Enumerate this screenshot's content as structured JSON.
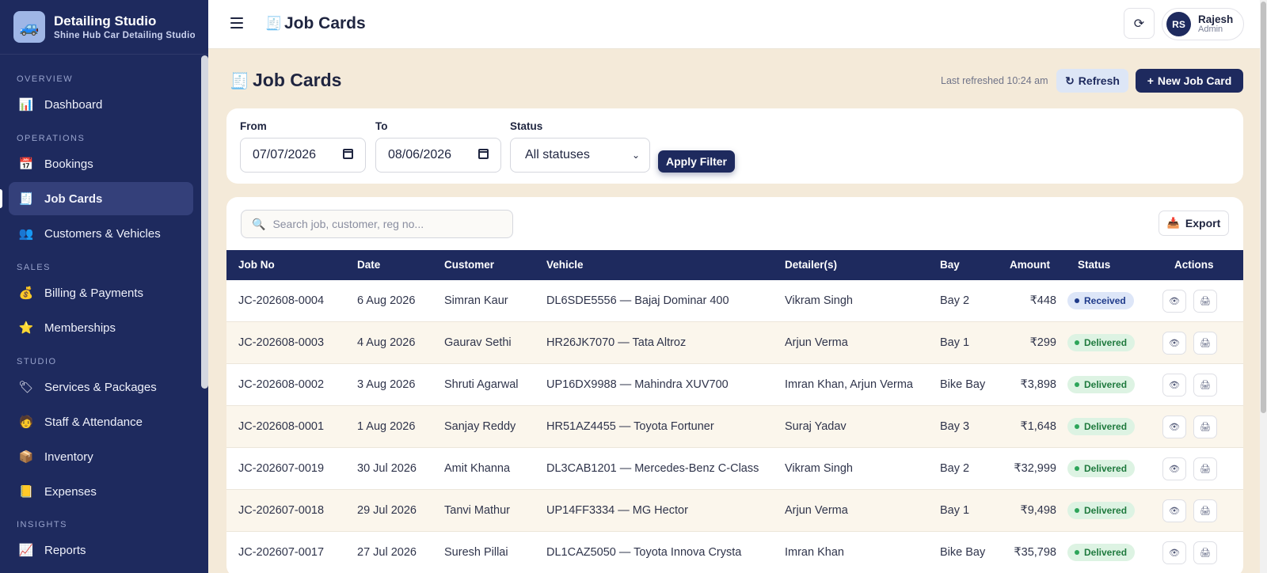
{
  "brand": {
    "logo_icon": "🚙",
    "title": "Detailing Studio",
    "subtitle": "Shine Hub Car Detailing Studio"
  },
  "sidebar": {
    "sections": {
      "overview": "OVERVIEW",
      "operations": "OPERATIONS",
      "sales": "SALES",
      "studio": "STUDIO",
      "insights": "INSIGHTS"
    },
    "items": [
      {
        "label": "Dashboard",
        "icon": "📊",
        "icon_name": "chart-icon"
      },
      {
        "label": "Bookings",
        "icon": "📅",
        "icon_name": "calendar-icon"
      },
      {
        "label": "Job Cards",
        "icon": "🧾",
        "icon_name": "receipt-icon",
        "active": true
      },
      {
        "label": "Customers & Vehicles",
        "icon": "👥",
        "icon_name": "people-icon"
      },
      {
        "label": "Billing & Payments",
        "icon": "💰",
        "icon_name": "money-bag-icon"
      },
      {
        "label": "Memberships",
        "icon": "⭐",
        "icon_name": "star-icon"
      },
      {
        "label": "Services & Packages",
        "icon": "🏷",
        "icon_name": "tag-icon"
      },
      {
        "label": "Staff & Attendance",
        "icon": "🧑",
        "icon_name": "staff-icon"
      },
      {
        "label": "Inventory",
        "icon": "📦",
        "icon_name": "box-icon"
      },
      {
        "label": "Expenses",
        "icon": "📒",
        "icon_name": "ledger-icon"
      },
      {
        "label": "Reports",
        "icon": "📈",
        "icon_name": "trend-chart-icon"
      }
    ]
  },
  "topbar": {
    "title_icon": "🧾",
    "title": "Job Cards",
    "refresh_icon": "⟳",
    "user": {
      "initials": "RS",
      "name": "Rajesh",
      "role": "Admin"
    }
  },
  "page": {
    "icon": "🧾",
    "title": "Job Cards",
    "last_refreshed": "Last refreshed 10:24 am",
    "refresh_icon": "↻",
    "refresh_label": "Refresh",
    "new_icon": "+",
    "new_label": "New Job Card"
  },
  "filters": {
    "from_label": "From",
    "from_value": "07/07/2026",
    "to_label": "To",
    "to_value": "08/06/2026",
    "status_label": "Status",
    "status_value": "All statuses",
    "caret": "⌄",
    "apply_label": "Apply Filter"
  },
  "table": {
    "search_icon": "🔍",
    "search_placeholder": "Search job, customer, reg no...",
    "export_icon": "📥",
    "export_label": "Export",
    "view_icon": "👁",
    "print_icon": "🖨",
    "columns": [
      "Job No",
      "Date",
      "Customer",
      "Vehicle",
      "Detailer(s)",
      "Bay",
      "Amount",
      "Status",
      "Actions"
    ],
    "rows": [
      {
        "job_no": "JC-202608-0004",
        "date": "6 Aug 2026",
        "customer": "Simran Kaur",
        "vehicle": "DL6SDE5556 — Bajaj Dominar 400",
        "detailers": "Vikram Singh",
        "bay": "Bay 2",
        "amount": "₹448",
        "status": "Received"
      },
      {
        "job_no": "JC-202608-0003",
        "date": "4 Aug 2026",
        "customer": "Gaurav Sethi",
        "vehicle": "HR26JK7070 — Tata Altroz",
        "detailers": "Arjun Verma",
        "bay": "Bay 1",
        "amount": "₹299",
        "status": "Delivered"
      },
      {
        "job_no": "JC-202608-0002",
        "date": "3 Aug 2026",
        "customer": "Shruti Agarwal",
        "vehicle": "UP16DX9988 — Mahindra XUV700",
        "detailers": "Imran Khan, Arjun Verma",
        "bay": "Bike Bay",
        "amount": "₹3,898",
        "status": "Delivered"
      },
      {
        "job_no": "JC-202608-0001",
        "date": "1 Aug 2026",
        "customer": "Sanjay Reddy",
        "vehicle": "HR51AZ4455 — Toyota Fortuner",
        "detailers": "Suraj Yadav",
        "bay": "Bay 3",
        "amount": "₹1,648",
        "status": "Delivered"
      },
      {
        "job_no": "JC-202607-0019",
        "date": "30 Jul 2026",
        "customer": "Amit Khanna",
        "vehicle": "DL3CAB1201 — Mercedes-Benz C-Class",
        "detailers": "Vikram Singh",
        "bay": "Bay 2",
        "amount": "₹32,999",
        "status": "Delivered"
      },
      {
        "job_no": "JC-202607-0018",
        "date": "29 Jul 2026",
        "customer": "Tanvi Mathur",
        "vehicle": "UP14FF3334 — MG Hector",
        "detailers": "Arjun Verma",
        "bay": "Bay 1",
        "amount": "₹9,498",
        "status": "Delivered"
      },
      {
        "job_no": "JC-202607-0017",
        "date": "27 Jul 2026",
        "customer": "Suresh Pillai",
        "vehicle": "DL1CAZ5050 — Toyota Innova Crysta",
        "detailers": "Imran Khan",
        "bay": "Bike Bay",
        "amount": "₹35,798",
        "status": "Delivered"
      }
    ]
  },
  "colors": {
    "navy": "#1e2a5e",
    "cream": "#f4ead9",
    "received_bg": "#dde6f8",
    "delivered_bg": "#ddf3e3"
  }
}
